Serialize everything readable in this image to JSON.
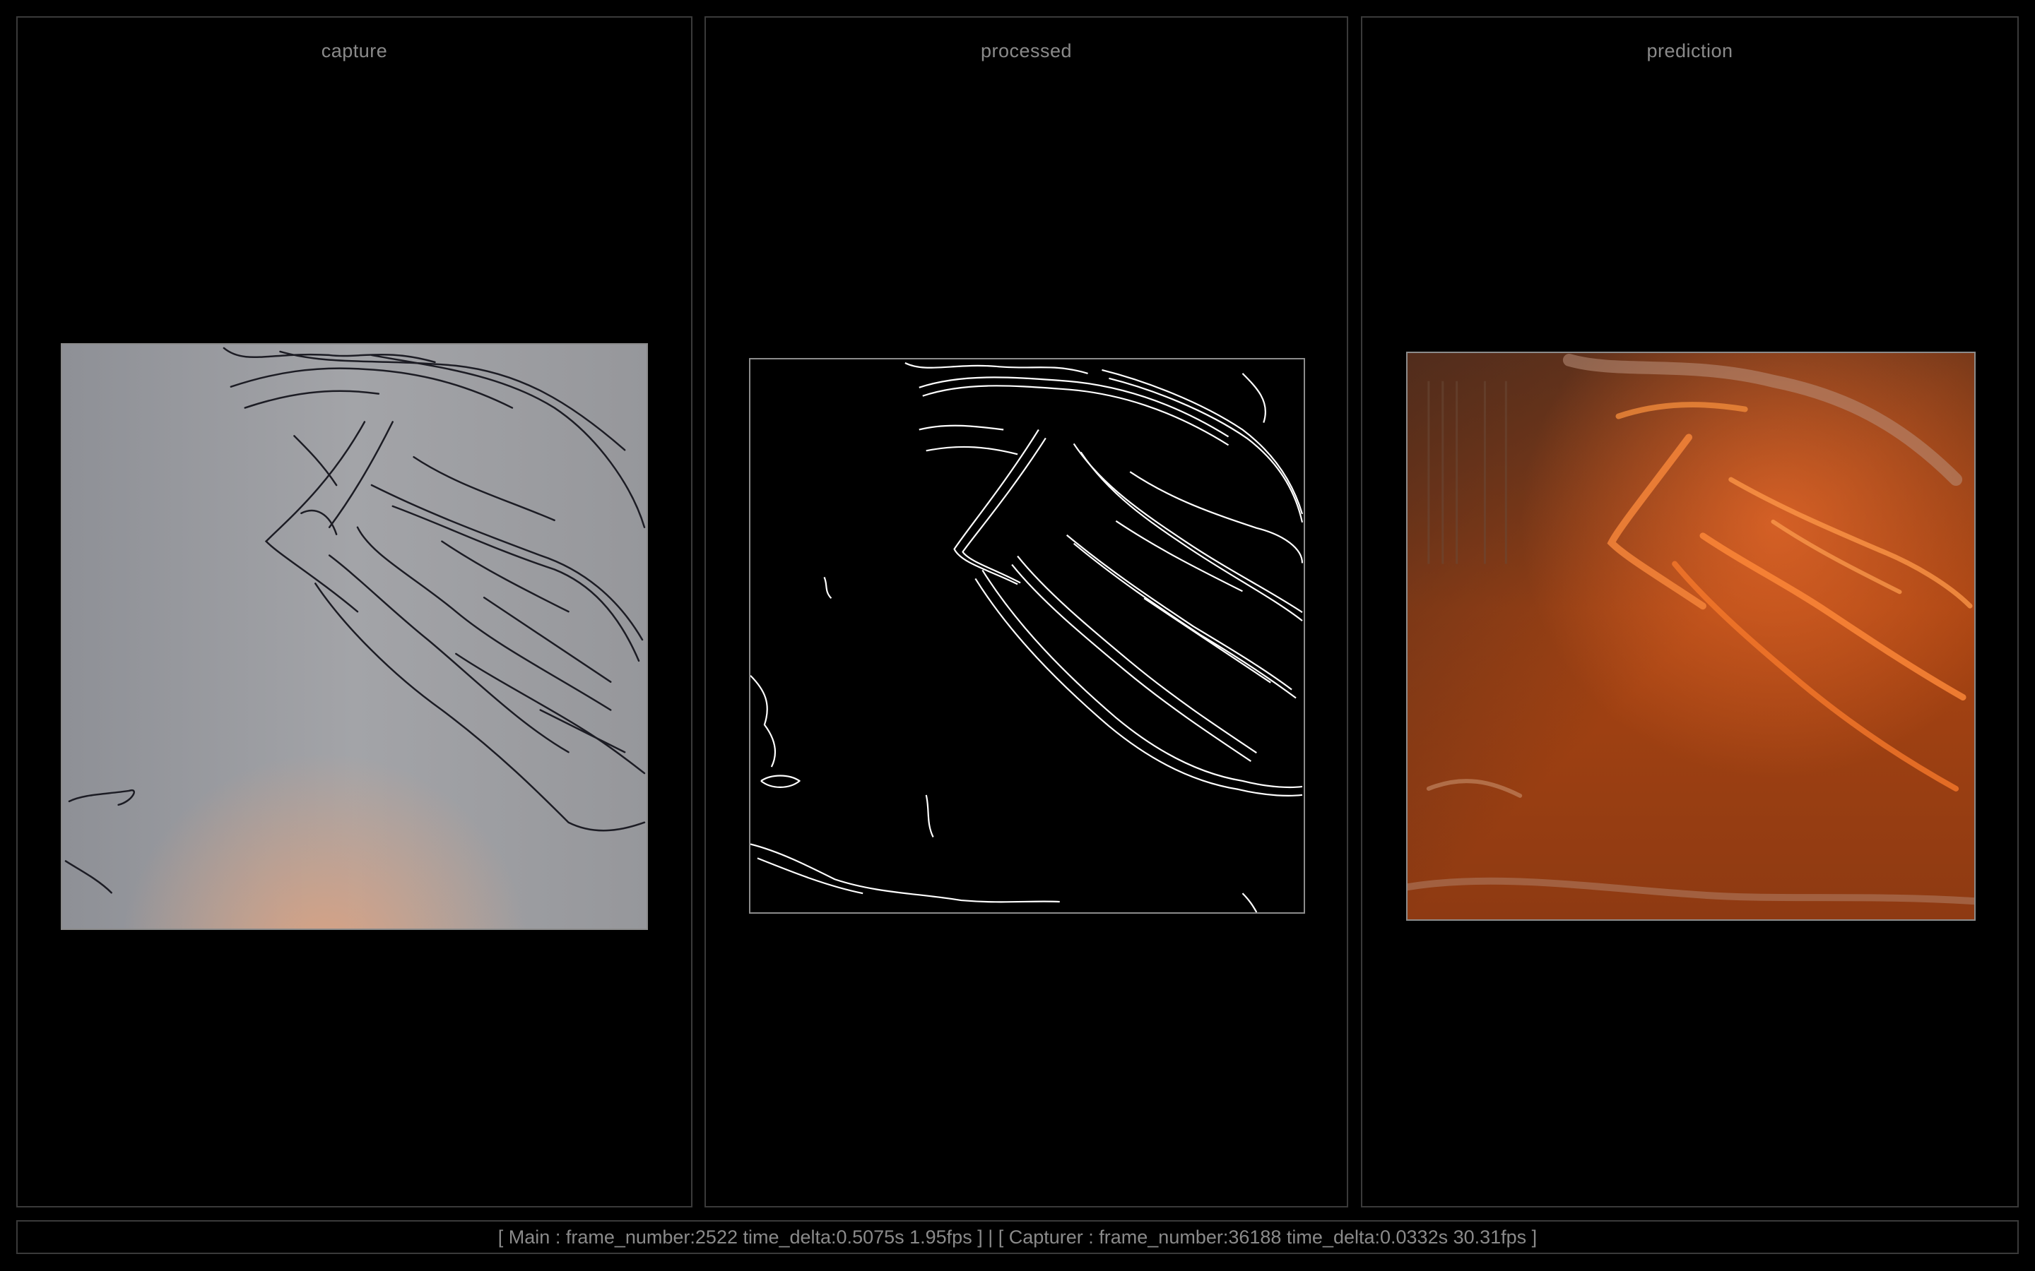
{
  "panels": {
    "capture": {
      "title": "capture"
    },
    "processed": {
      "title": "processed"
    },
    "prediction": {
      "title": "prediction"
    }
  },
  "status_bar": {
    "text": "[ Main : frame_number:2522 time_delta:0.5075s 1.95fps ] | [ Capturer : frame_number:36188 time_delta:0.0332s 30.31fps ]"
  },
  "colors": {
    "background": "#000000",
    "panel_border": "#3a3a3a",
    "label_text": "#8a8a8a",
    "capture_paper": "#9a9ba0",
    "sketch_ink": "#1a1a22",
    "edge_lines": "#ffffff",
    "prediction_base": "#a33f10",
    "prediction_highlight": "#f07a2a"
  }
}
